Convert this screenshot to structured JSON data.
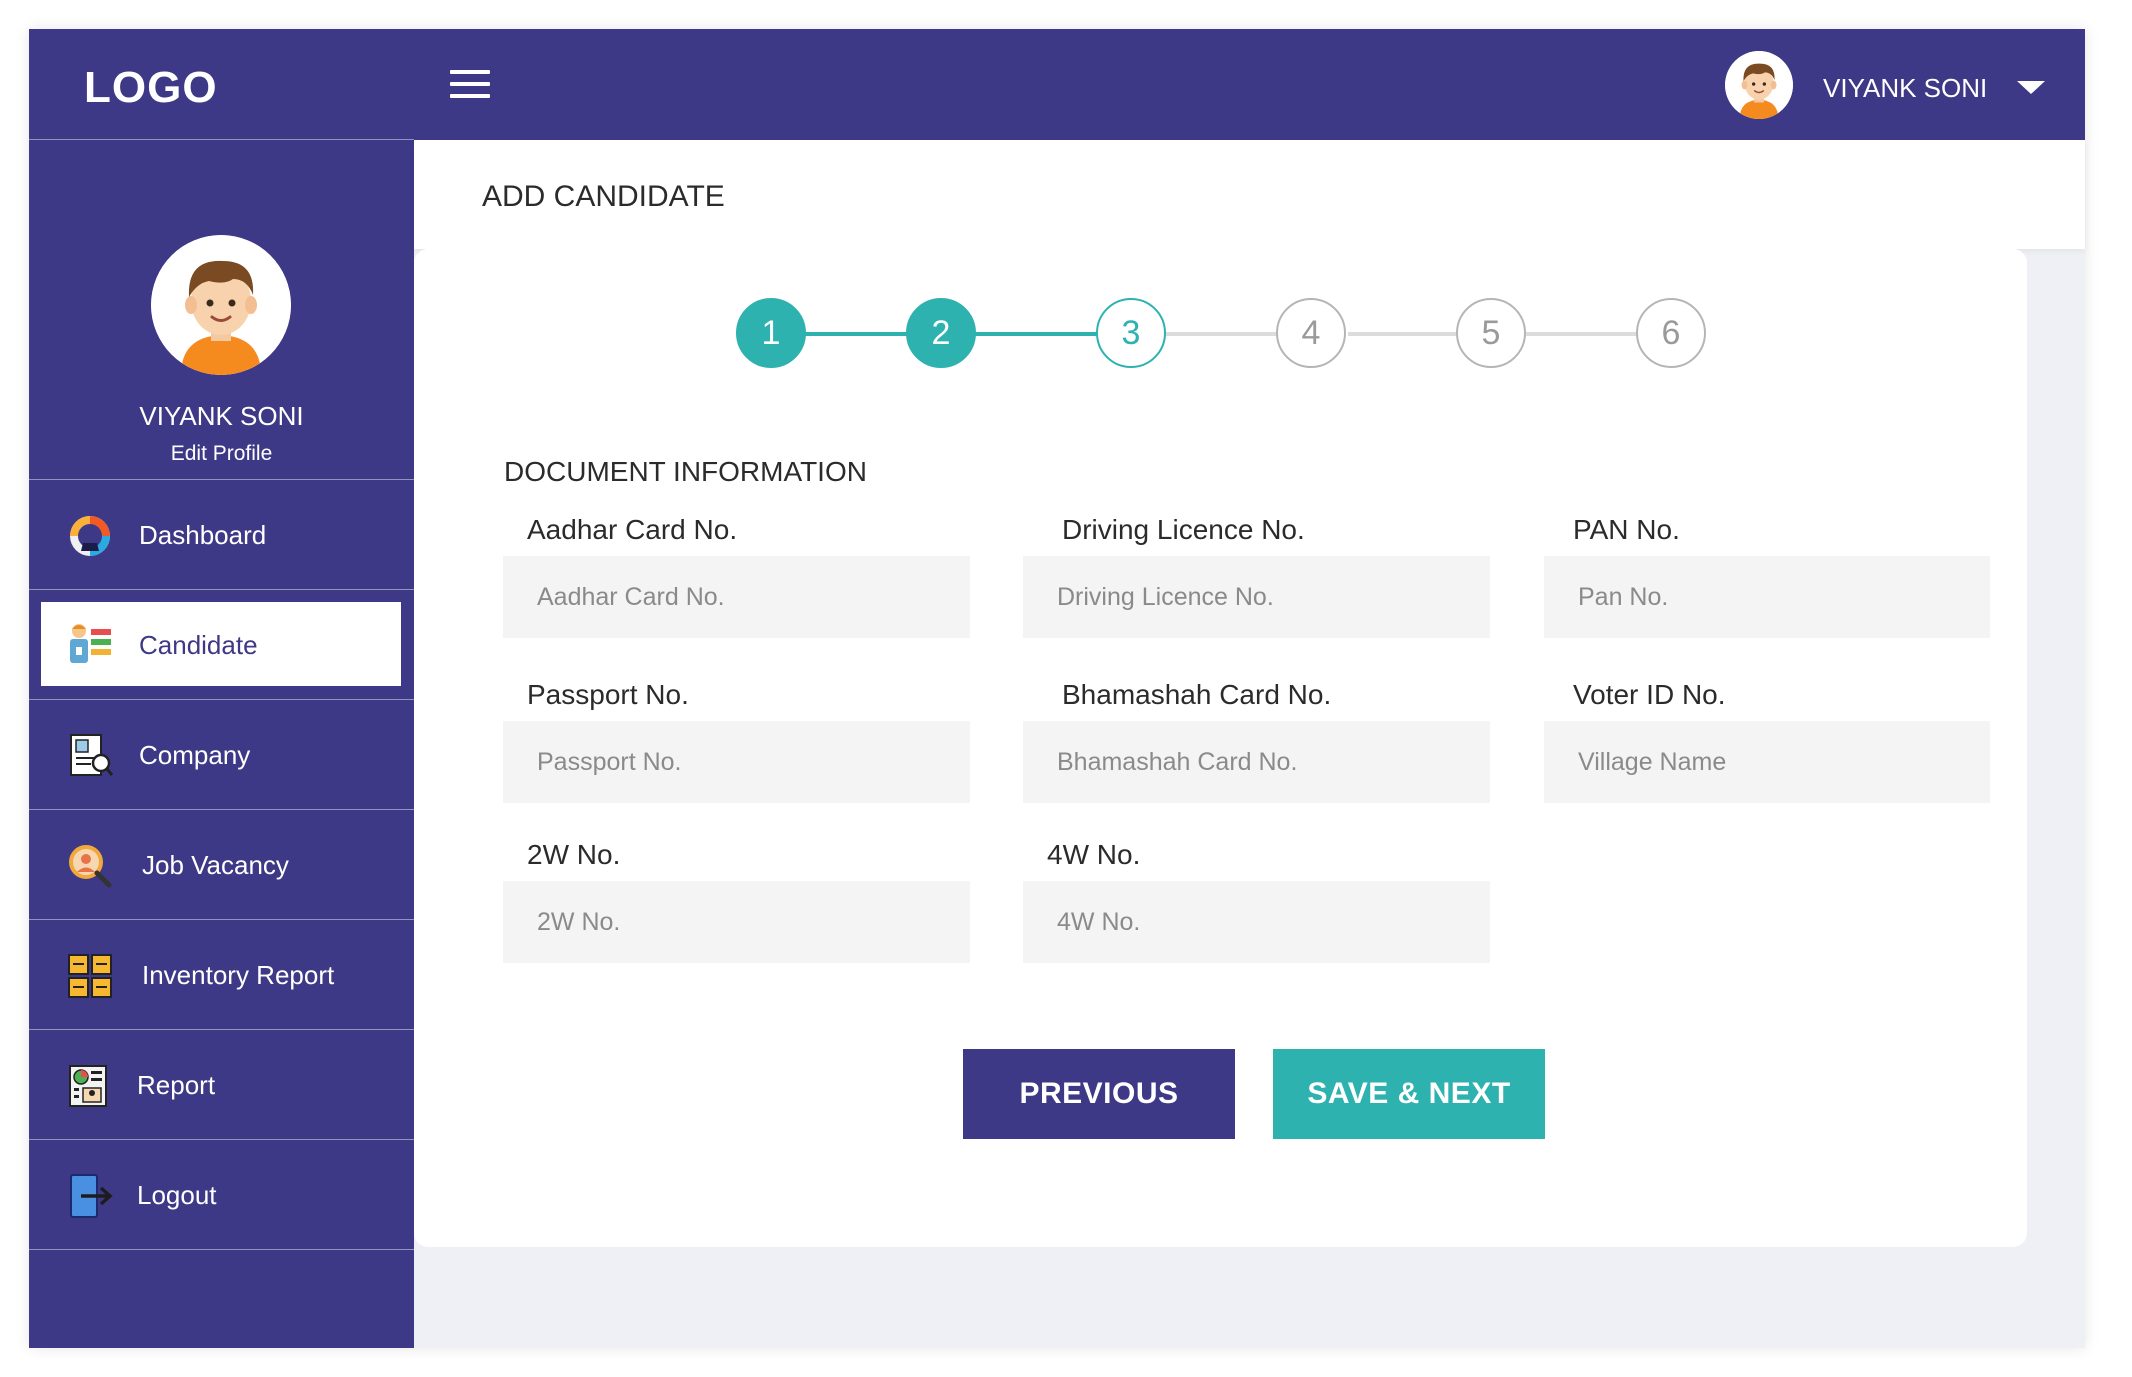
{
  "sidebar": {
    "logo": "LOGO",
    "profile_name": "VIYANK SONI",
    "edit_profile": "Edit Profile",
    "items": [
      {
        "label": "Dashboard",
        "icon": "dashboard-gauge-icon"
      },
      {
        "label": "Candidate",
        "icon": "candidate-icon",
        "active": true
      },
      {
        "label": "Company",
        "icon": "company-icon"
      },
      {
        "label": "Job Vacancy",
        "icon": "job-vacancy-icon"
      },
      {
        "label": "Inventory Report",
        "icon": "inventory-report-icon"
      },
      {
        "label": "Report",
        "icon": "report-icon"
      },
      {
        "label": "Logout",
        "icon": "logout-icon"
      }
    ]
  },
  "topbar": {
    "user_name": "VIYANK SONI",
    "menu_icon": "hamburger-icon",
    "caret_icon": "caret-down-icon"
  },
  "page": {
    "title": "ADD CANDIDATE"
  },
  "steps": {
    "labels": [
      "1",
      "2",
      "3",
      "4",
      "5",
      "6"
    ],
    "current": 3,
    "colors": {
      "done": "#2eb2b0",
      "todo": "#b5b5b5"
    }
  },
  "form": {
    "section_title": "DOCUMENT INFORMATION",
    "fields": [
      {
        "label": "Aadhar Card No.",
        "placeholder": "Aadhar Card No.",
        "value": ""
      },
      {
        "label": "Driving Licence No.",
        "placeholder": "Driving Licence No.",
        "value": ""
      },
      {
        "label": "PAN No.",
        "placeholder": "Pan No.",
        "value": ""
      },
      {
        "label": "Passport No.",
        "placeholder": "Passport No.",
        "value": ""
      },
      {
        "label": "Bhamashah Card No.",
        "placeholder": "Bhamashah Card No.",
        "value": ""
      },
      {
        "label": "Voter ID No.",
        "placeholder": "Village Name",
        "value": ""
      },
      {
        "label": "2W No.",
        "placeholder": "2W No.",
        "value": ""
      },
      {
        "label": "4W No.",
        "placeholder": "4W No.",
        "value": ""
      }
    ],
    "previous_label": "PREVIOUS",
    "next_label": "SAVE & NEXT"
  },
  "colors": {
    "primary": "#3e3986",
    "accent": "#2eb2b0",
    "background": "#eef0f5"
  }
}
